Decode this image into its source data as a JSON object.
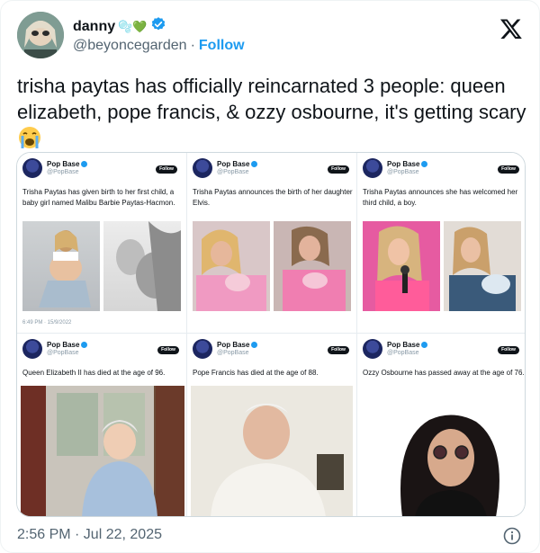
{
  "user": {
    "display_name": "danny",
    "name_emojis": "🫧💚",
    "handle": "@beyoncegarden",
    "separator": "·",
    "follow_label": "Follow"
  },
  "tweet": {
    "text": "trisha paytas has officially reincarnated 3 people: queen elizabeth, pope francis, & ozzy osbourne, it's getting scary",
    "emoji": "😭"
  },
  "media": {
    "posts": [
      {
        "account": "Pop Base",
        "handle": "@PopBase",
        "follow": "Follow",
        "text": "Trisha Paytas has given birth to her first child, a baby girl named Malibu Barbie Paytas-Hacmon.",
        "timestamp": "6:49 PM · 15/9/2022"
      },
      {
        "account": "Pop Base",
        "handle": "@PopBase",
        "follow": "Follow",
        "text": "Trisha Paytas announces the birth of her daughter Elvis."
      },
      {
        "account": "Pop Base",
        "handle": "@PopBase",
        "follow": "Follow",
        "text": "Trisha Paytas announces she has welcomed her third child, a boy."
      },
      {
        "account": "Pop Base",
        "handle": "@PopBase",
        "follow": "Follow",
        "text": "Queen Elizabeth II has died at the age of 96."
      },
      {
        "account": "Pop Base",
        "handle": "@PopBase",
        "follow": "Follow",
        "text": "Pope Francis has died at the age of 88."
      },
      {
        "account": "Pop Base",
        "handle": "@PopBase",
        "follow": "Follow",
        "text": "Ozzy Osbourne has passed away at the age of 76."
      }
    ]
  },
  "footer": {
    "timestamp": "2:56 PM · Jul 22, 2025"
  },
  "colors": {
    "accent": "#1d9bf0",
    "text": "#0f1419",
    "muted": "#536471"
  },
  "icons": {
    "logo": "x-logo-icon",
    "verified": "verified-badge-icon",
    "info": "info-icon"
  }
}
